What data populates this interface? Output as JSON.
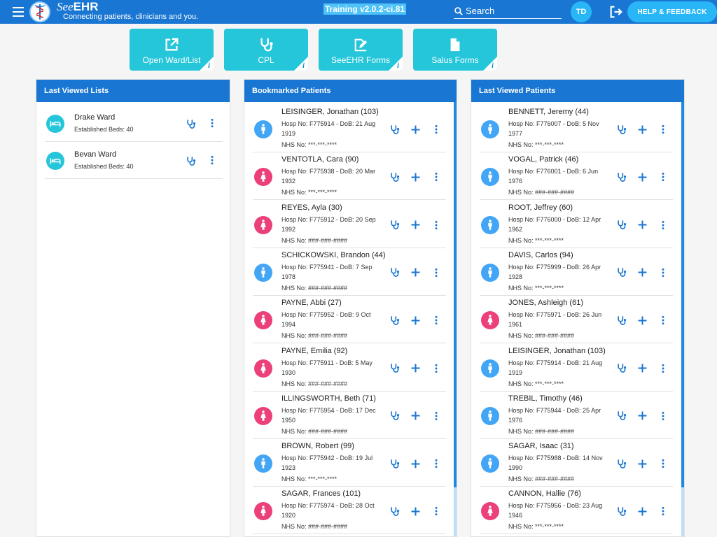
{
  "header": {
    "brand_prefix": "See",
    "brand_suffix": "EHR",
    "tagline": "Connecting patients, clinicians and you.",
    "version": "Training v2.0.2-ci.81",
    "search_placeholder": "Search",
    "user_initials": "TD",
    "help_label": "HELP & FEEDBACK"
  },
  "tiles": [
    {
      "label": "Open Ward/List",
      "icon": "open-external-icon",
      "info": "i"
    },
    {
      "label": "CPL",
      "icon": "stethoscope-icon",
      "info": "i"
    },
    {
      "label": "SeeEHR Forms",
      "icon": "form-edit-icon",
      "info": "i"
    },
    {
      "label": "Salus Forms",
      "icon": "document-icon",
      "info": "i"
    }
  ],
  "last_lists": {
    "title": "Last Viewed Lists",
    "items": [
      {
        "name": "Drake Ward",
        "detail": "Established Beds: 40"
      },
      {
        "name": "Bevan Ward",
        "detail": "Established Beds: 40"
      }
    ]
  },
  "bookmarked": {
    "title": "Bookmarked Patients",
    "items": [
      {
        "name": "LEISINGER, Jonathan (103)",
        "hosp": "Hosp No: F775914 - DoB: 21 Aug 1919",
        "nhs": "NHS No: ***-***-****",
        "sex": "male"
      },
      {
        "name": "VENTOTLA, Cara (90)",
        "hosp": "Hosp No: F775938 - DoB: 20 Mar 1932",
        "nhs": "NHS No: ***-***-****",
        "sex": "female"
      },
      {
        "name": "REYES, Ayla (30)",
        "hosp": "Hosp No: F775912 - DoB: 20 Sep 1992",
        "nhs": "NHS No: ###-###-####",
        "sex": "female"
      },
      {
        "name": "SCHICKOWSKI, Brandon (44)",
        "hosp": "Hosp No: F775941 - DoB: 7 Sep 1978",
        "nhs": "NHS No: ###-###-####",
        "sex": "male"
      },
      {
        "name": "PAYNE, Abbi (27)",
        "hosp": "Hosp No: F775952 - DoB: 9 Oct 1994",
        "nhs": "NHS No: ###-###-####",
        "sex": "female"
      },
      {
        "name": "PAYNE, Emilia (92)",
        "hosp": "Hosp No: F775911 - DoB: 5 May 1930",
        "nhs": "NHS No: ###-###-####",
        "sex": "female"
      },
      {
        "name": "ILLINGSWORTH, Beth (71)",
        "hosp": "Hosp No: F775954 - DoB: 17 Dec 1950",
        "nhs": "NHS No: ###-###-####",
        "sex": "female"
      },
      {
        "name": "BROWN, Robert (99)",
        "hosp": "Hosp No: F775942 - DoB: 19 Jul 1923",
        "nhs": "NHS No: ***-***-****",
        "sex": "male"
      },
      {
        "name": "SAGAR, Frances (101)",
        "hosp": "Hosp No: F775974 - DoB: 28 Oct 1920",
        "nhs": "NHS No: ###-###-####",
        "sex": "female"
      }
    ]
  },
  "last_patients": {
    "title": "Last Viewed Patients",
    "items": [
      {
        "name": "BENNETT, Jeremy (44)",
        "hosp": "Hosp No: F776007 - DoB: 5 Nov 1977",
        "nhs": "NHS No: ***-***-****",
        "sex": "male"
      },
      {
        "name": "VOGAL, Patrick (46)",
        "hosp": "Hosp No: F776001 - DoB: 6 Jun 1976",
        "nhs": "NHS No: ###-###-####",
        "sex": "male"
      },
      {
        "name": "ROOT, Jeffrey (60)",
        "hosp": "Hosp No: F776000 - DoB: 12 Apr 1962",
        "nhs": "NHS No: ***-***-****",
        "sex": "male"
      },
      {
        "name": "DAVIS, Carlos (94)",
        "hosp": "Hosp No: F775999 - DoB: 26 Apr 1928",
        "nhs": "NHS No: ***-***-****",
        "sex": "male"
      },
      {
        "name": "JONES, Ashleigh (61)",
        "hosp": "Hosp No: F775971 - DoB: 26 Jun 1961",
        "nhs": "NHS No: ###-###-####",
        "sex": "female"
      },
      {
        "name": "LEISINGER, Jonathan (103)",
        "hosp": "Hosp No: F775914 - DoB: 21 Aug 1919",
        "nhs": "NHS No: ***-***-****",
        "sex": "male"
      },
      {
        "name": "TREBIL, Timothy (46)",
        "hosp": "Hosp No: F775944 - DoB: 25 Apr 1976",
        "nhs": "NHS No: ###-###-####",
        "sex": "male"
      },
      {
        "name": "SAGAR, Isaac (31)",
        "hosp": "Hosp No: F775988 - DoB: 14 Nov 1990",
        "nhs": "NHS No: ###-###-####",
        "sex": "male"
      },
      {
        "name": "CANNON, Hallie (76)",
        "hosp": "Hosp No: F775956 - DoB: 23 Aug 1946",
        "nhs": "NHS No: ***-***-****",
        "sex": "female"
      }
    ]
  },
  "colors": {
    "primary": "#1976d2",
    "tile": "#26c6da",
    "male": "#42a5f5",
    "female": "#ec407a",
    "action": "#1976d2"
  }
}
